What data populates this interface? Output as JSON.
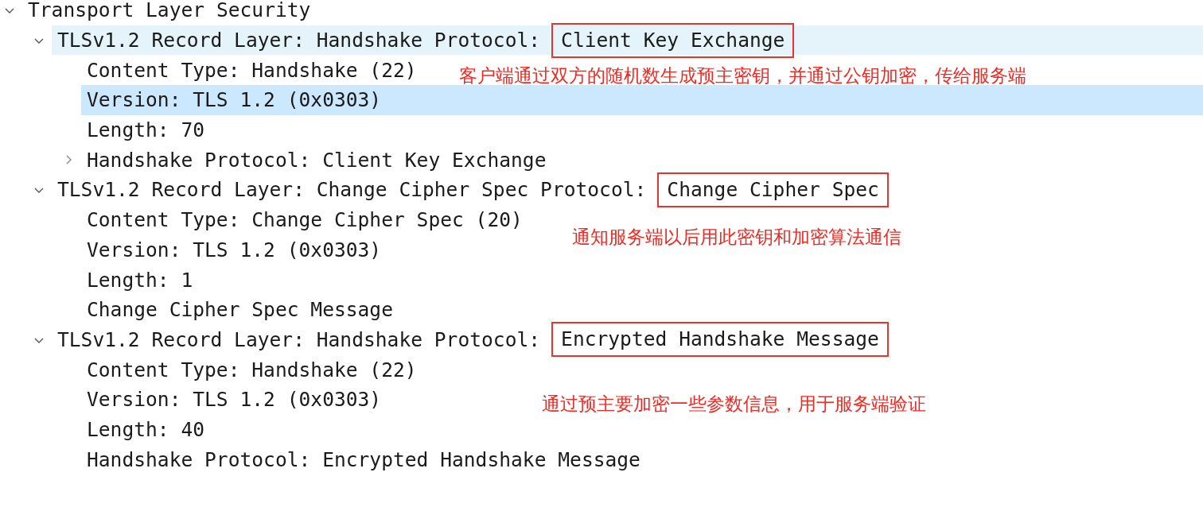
{
  "tree": [
    {
      "label": "Transport Layer Security",
      "expanded": true,
      "selected": false,
      "hovered": false,
      "children": [
        {
          "label": "TLSv1.2 Record Layer: Handshake Protocol:",
          "boxed": "Client Key Exchange",
          "expanded": true,
          "selected": false,
          "hovered": true,
          "children": [
            {
              "label": "Content Type: Handshake (22)",
              "selected": false,
              "hovered": false
            },
            {
              "label": "Version: TLS 1.2 (0x0303)",
              "selected": true,
              "hovered": false
            },
            {
              "label": "Length: 70",
              "selected": false,
              "hovered": false
            },
            {
              "label": "Handshake Protocol: Client Key Exchange",
              "expanded": false,
              "selected": false,
              "hovered": false
            }
          ]
        },
        {
          "label": "TLSv1.2 Record Layer: Change Cipher Spec Protocol:",
          "boxed": "Change Cipher Spec",
          "expanded": true,
          "selected": false,
          "hovered": false,
          "children": [
            {
              "label": "Content Type: Change Cipher Spec (20)",
              "selected": false,
              "hovered": false
            },
            {
              "label": "Version: TLS 1.2 (0x0303)",
              "selected": false,
              "hovered": false
            },
            {
              "label": "Length: 1",
              "selected": false,
              "hovered": false
            },
            {
              "label": "Change Cipher Spec Message",
              "selected": false,
              "hovered": false
            }
          ]
        },
        {
          "label": "TLSv1.2 Record Layer: Handshake Protocol:",
          "boxed": "Encrypted Handshake Message",
          "expanded": true,
          "selected": false,
          "hovered": false,
          "children": [
            {
              "label": "Content Type: Handshake (22)",
              "selected": false,
              "hovered": false
            },
            {
              "label": "Version: TLS 1.2 (0x0303)",
              "selected": false,
              "hovered": false
            },
            {
              "label": "Length: 40",
              "selected": false,
              "hovered": false
            },
            {
              "label": "Handshake Protocol: Encrypted Handshake Message",
              "selected": false,
              "hovered": false
            }
          ]
        }
      ]
    }
  ],
  "annotations": [
    "客户端通过双方的随机数生成预主密钥，并通过公钥加密，传给服务端",
    "通知服务端以后用此密钥和加密算法通信",
    "通过预主要加密一些参数信息，用于服务端验证"
  ]
}
